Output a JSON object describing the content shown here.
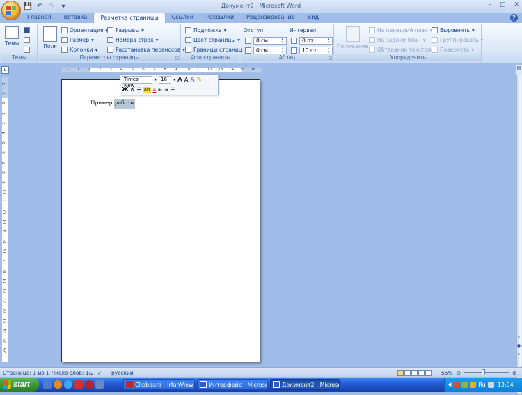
{
  "window": {
    "title": "Документ2 - Microsoft Word",
    "controls": [
      "–",
      "□",
      "✕"
    ]
  },
  "ribbon_tabs": [
    "Главная",
    "Вставка",
    "Разметка страницы",
    "Ссылки",
    "Рассылки",
    "Рецензирование",
    "Вид"
  ],
  "active_tab": "Разметка страницы",
  "groups": {
    "themes": {
      "label": "Темы",
      "btn": "Темы"
    },
    "page_setup": {
      "label": "Параметры страницы",
      "fields": "Поля",
      "orientation": "Ориентация",
      "size": "Размер",
      "columns": "Колонки",
      "breaks": "Разрывы",
      "line_numbers": "Номера строк",
      "hyphenation": "Расстановка переносов"
    },
    "page_background": {
      "label": "Фон страницы",
      "watermark": "Подложка",
      "page_color": "Цвет страницы",
      "page_borders": "Границы страниц"
    },
    "paragraph": {
      "label": "Абзац",
      "indent_title": "Отступ",
      "spacing_title": "Интервал",
      "indent_left": "0 см",
      "indent_right": "0 см",
      "spacing_before": "0 пт",
      "spacing_after": "10 пт"
    },
    "arrange": {
      "label": "Упорядочить",
      "position": "Положение",
      "bring_front": "На передний план",
      "send_back": "На задний план",
      "text_wrap": "Обтекание текстом",
      "align": "Выровнять",
      "group": "Группировать",
      "rotate": "Повернуть"
    }
  },
  "ruler": {
    "h_ticks": [
      "2",
      "1",
      "1",
      "2",
      "3",
      "4",
      "5",
      "6",
      "7",
      "8",
      "9",
      "10",
      "11",
      "12",
      "13",
      "14",
      "15",
      "16"
    ],
    "v_ticks": [
      "2",
      "1",
      "1",
      "2",
      "3",
      "4",
      "5",
      "6",
      "7",
      "8",
      "9",
      "10",
      "11",
      "12",
      "13",
      "14",
      "15",
      "16",
      "17",
      "18",
      "19",
      "20",
      "21",
      "22",
      "23",
      "24",
      "25",
      "26"
    ]
  },
  "document": {
    "text_plain": "Пример ",
    "text_selected": "работы"
  },
  "mini_toolbar": {
    "font": "Times New",
    "size": "16",
    "grow": "A",
    "shrink": "A",
    "bold": "Ж",
    "italic": "К"
  },
  "statusbar": {
    "page": "Страница: 1 из 1",
    "words": "Число слов: 1/2",
    "language": "русский",
    "zoom": "55%",
    "zoom_level": 0.44
  },
  "taskbar": {
    "start": "start",
    "tasks": [
      {
        "label": "Clipboard - IrfanView",
        "color": "#d02020"
      },
      {
        "label": "Интерфейс - Microso...",
        "color": "#2b5fc6"
      },
      {
        "label": "Документ2 - Microso...",
        "color": "#2b5fc6"
      }
    ],
    "lang_ind": "RU",
    "tray_lang": "Ru",
    "clock": "13:04"
  }
}
